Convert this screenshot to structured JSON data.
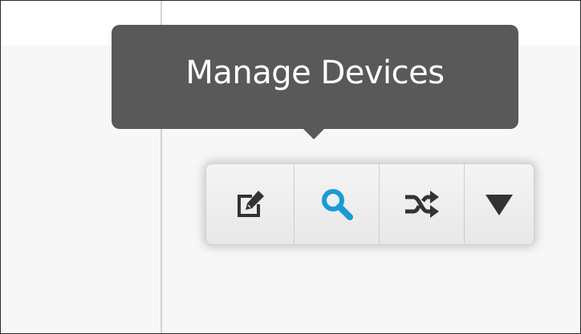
{
  "tooltip": {
    "text": "Manage Devices"
  },
  "toolbar": {
    "buttons": [
      {
        "icon": "edit-icon",
        "color": "#333333"
      },
      {
        "icon": "search-icon",
        "color": "#1a9ad6"
      },
      {
        "icon": "shuffle-icon",
        "color": "#333333"
      },
      {
        "icon": "caret-down-icon",
        "color": "#333333"
      }
    ]
  },
  "colors": {
    "tooltip_bg": "#595959",
    "accent": "#1a9ad6",
    "icon": "#333333"
  }
}
